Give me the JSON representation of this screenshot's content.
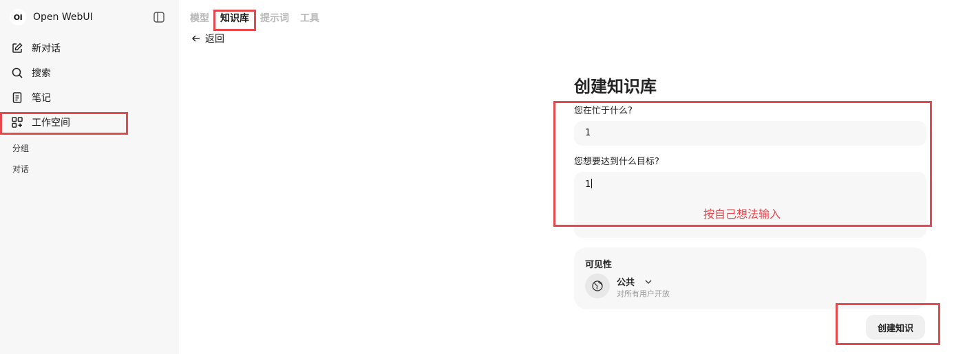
{
  "brand": {
    "name": "Open WebUI",
    "logo_text": "OI"
  },
  "sidebar": {
    "items": [
      {
        "label": "新对话",
        "icon": "edit-icon"
      },
      {
        "label": "搜索",
        "icon": "search-icon"
      },
      {
        "label": "笔记",
        "icon": "notes-icon"
      },
      {
        "label": "工作空间",
        "icon": "workspace-icon"
      }
    ],
    "sections": [
      "分组",
      "对话"
    ]
  },
  "tabs": [
    {
      "label": "模型",
      "active": false
    },
    {
      "label": "知识库",
      "active": true
    },
    {
      "label": "提示词",
      "active": false
    },
    {
      "label": "工具",
      "active": false
    }
  ],
  "back_label": "返回",
  "form": {
    "title": "创建知识库",
    "name_label": "您在忙于什么?",
    "name_value": "1",
    "desc_label": "您想要达到什么目标?",
    "desc_value": "1",
    "visibility": {
      "label": "可见性",
      "value": "公共",
      "description": "对所有用户开放"
    },
    "submit_label": "创建知识"
  },
  "annotation": {
    "text": "按自己想法输入",
    "color": "#e5484d"
  }
}
